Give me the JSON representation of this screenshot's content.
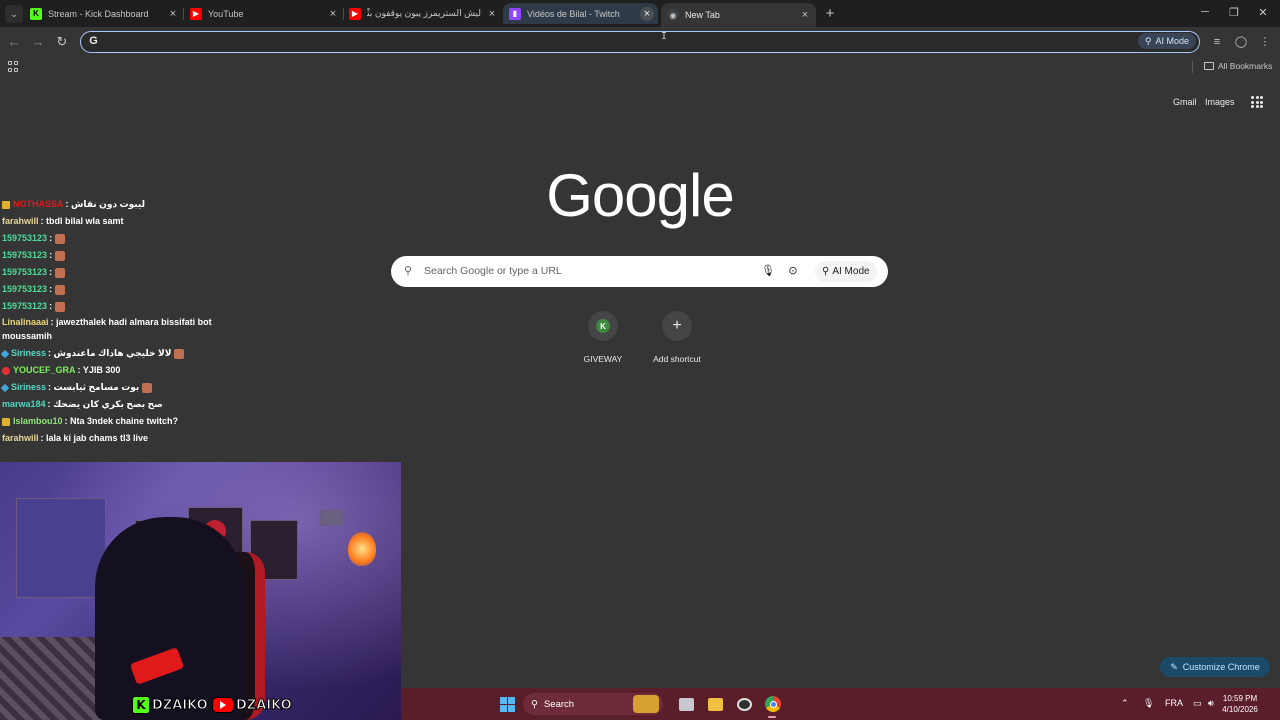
{
  "tabs": [
    {
      "title": "Stream - Kick Dashboard",
      "icon": "kick-icon",
      "color": "#53fc18"
    },
    {
      "title": "YouTube",
      "icon": "youtube-icon",
      "color": "#ff0000"
    },
    {
      "title": "ليش الستريمرز يبون يوقفون بثّوت...",
      "icon": "youtube-icon",
      "color": "#ff0000"
    },
    {
      "title": "Vidéos de Bilal - Twitch",
      "icon": "twitch-icon",
      "color": "#9146ff"
    },
    {
      "title": "New Tab",
      "icon": "chrome-icon",
      "color": "#8ab4f8"
    }
  ],
  "omnibox": {
    "value": "",
    "ai_mode_label": "AI Mode"
  },
  "bookmarks": {
    "all_bookmarks_label": "All Bookmarks"
  },
  "ntp": {
    "gmail_label": "Gmail",
    "images_label": "Images",
    "logo_text": "Google",
    "search_placeholder": "Search Google or type a URL",
    "ai_mode_label": "AI Mode",
    "shortcuts": [
      {
        "label": "GIVEWAY",
        "initial": "K"
      },
      {
        "label": "Add shortcut",
        "initial": "+"
      }
    ],
    "customize_label": "Customize Chrome"
  },
  "chat": [
    {
      "user": "NOTHASSA",
      "text": ": ليبوت دون نقاش",
      "color": "c-red",
      "badge": "crown"
    },
    {
      "user": "farahwill",
      "text": ": tbdl bilal wla samt",
      "color": "c-beige",
      "badge": ""
    },
    {
      "user": "159753123",
      "text": ":",
      "color": "c-green",
      "badge": "",
      "emoji": true
    },
    {
      "user": "159753123",
      "text": ":",
      "color": "c-green",
      "badge": "",
      "emoji": true
    },
    {
      "user": "159753123",
      "text": ":",
      "color": "c-green",
      "badge": "",
      "emoji": true
    },
    {
      "user": "159753123",
      "text": ":",
      "color": "c-green",
      "badge": "",
      "emoji": true
    },
    {
      "user": "159753123",
      "text": ":",
      "color": "c-green",
      "badge": "",
      "emoji": true
    },
    {
      "user": "Linalinaaai",
      "text": ": jawezthalek hadi almara bissifati bot moussamih",
      "color": "c-yellow",
      "badge": "",
      "wrap": true
    },
    {
      "user": "Siriness",
      "text": ": لالا خليجي هاداك ماعندوش",
      "color": "c-cyan",
      "badge": "gem",
      "emoji": true
    },
    {
      "user": "YOUCEF_GRA",
      "text": ": YJIB 300",
      "color": "c-lime",
      "badge": "dot"
    },
    {
      "user": "Siriness",
      "text": ": بوت مسامح ثيابست",
      "color": "c-cyan",
      "badge": "gem",
      "emoji": true
    },
    {
      "user": "marwa184",
      "text": ": صح بصح بكري كان يضحك",
      "color": "c-teal",
      "badge": ""
    },
    {
      "user": "Islambou10",
      "text": ": Nta 3ndek chaine twitch?",
      "color": "c-lightgreen",
      "badge": "crown"
    },
    {
      "user": "farahwill",
      "text": ": lala ki jab chams tl3 live",
      "color": "c-beige",
      "badge": ""
    }
  ],
  "brand": {
    "kick_name": "DZAIKO",
    "yt_name": "DZAIKO",
    "kick_letter": "K"
  },
  "taskbar": {
    "search_label": "Search",
    "lang": "FRA",
    "time": "10:59 PM",
    "date": "4/10/2026"
  },
  "colors": {
    "accent": "#a8c7fa",
    "taskbar": "#5a1d2a",
    "page_bg": "#353535"
  }
}
